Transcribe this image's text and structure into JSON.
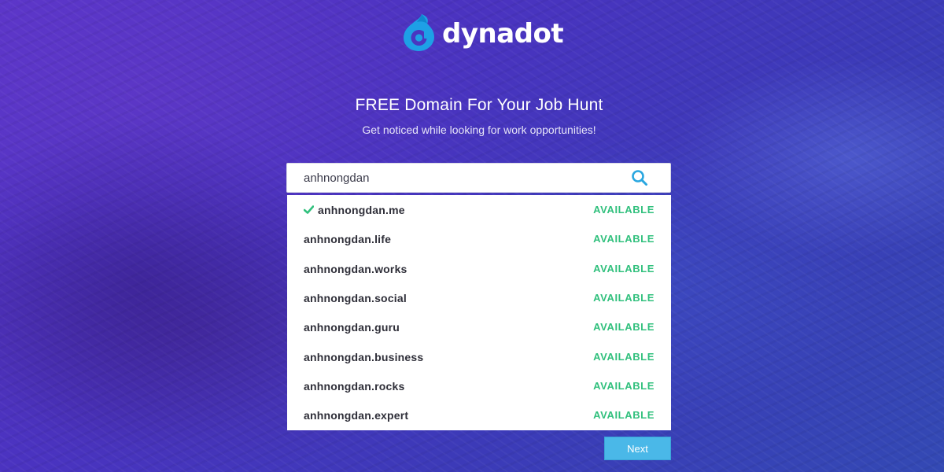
{
  "brand": {
    "name": "dynadot",
    "icon": "dynadot-logo-icon",
    "icon_color": "#1ea0e6"
  },
  "hero": {
    "title": "FREE Domain For Your Job Hunt",
    "subtitle": "Get noticed while looking for work opportunities!"
  },
  "search": {
    "value": "anhnongdan",
    "icon": "search-icon",
    "icon_color": "#2aa7e0"
  },
  "results": [
    {
      "domain": "anhnongdan.me",
      "status": "AVAILABLE",
      "selected": true
    },
    {
      "domain": "anhnongdan.life",
      "status": "AVAILABLE",
      "selected": false
    },
    {
      "domain": "anhnongdan.works",
      "status": "AVAILABLE",
      "selected": false
    },
    {
      "domain": "anhnongdan.social",
      "status": "AVAILABLE",
      "selected": false
    },
    {
      "domain": "anhnongdan.guru",
      "status": "AVAILABLE",
      "selected": false
    },
    {
      "domain": "anhnongdan.business",
      "status": "AVAILABLE",
      "selected": false
    },
    {
      "domain": "anhnongdan.rocks",
      "status": "AVAILABLE",
      "selected": false
    },
    {
      "domain": "anhnongdan.expert",
      "status": "AVAILABLE",
      "selected": false
    }
  ],
  "status_color": "#31c07d",
  "actions": {
    "next_label": "Next",
    "next_color": "#4ab8e8"
  }
}
